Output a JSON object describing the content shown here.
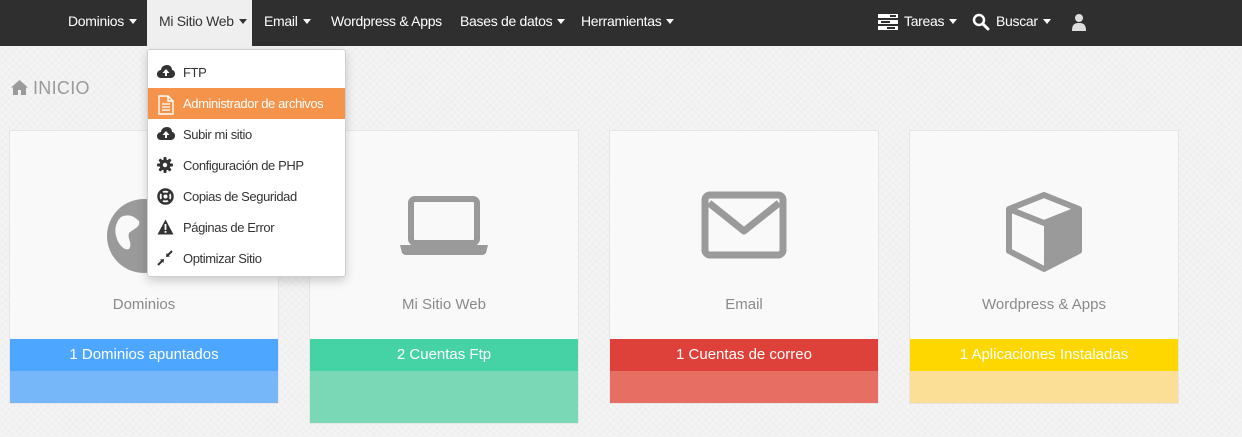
{
  "navbar": {
    "items": [
      {
        "label": "Dominios",
        "active": false
      },
      {
        "label": "Mi Sitio Web",
        "active": true
      },
      {
        "label": "Email",
        "active": false
      },
      {
        "label": "Wordpress & Apps",
        "active": false
      },
      {
        "label": "Bases de datos",
        "active": false
      },
      {
        "label": "Herramientas",
        "active": false
      }
    ],
    "tasks_label": "Tareas",
    "search_label": "Buscar",
    "user_icon": "user-icon"
  },
  "dropdown": {
    "items": [
      {
        "label": "FTP",
        "icon": "cloud-upload-icon"
      },
      {
        "label": "Administrador de archivos",
        "icon": "file-icon",
        "active": true
      },
      {
        "label": "Subir mi sitio",
        "icon": "cloud-upload-icon"
      },
      {
        "label": "Configuración de PHP",
        "icon": "gear-icon"
      },
      {
        "label": "Copias de Seguridad",
        "icon": "lifebuoy-icon"
      },
      {
        "label": "Páginas de Error",
        "icon": "warning-icon"
      },
      {
        "label": "Optimizar Sitio",
        "icon": "compress-icon"
      }
    ],
    "active_color": "#f49349"
  },
  "page": {
    "title": "INICIO"
  },
  "cards": [
    {
      "label": "Dominios",
      "stat": "1 Dominios apuntados",
      "icon": "globe-icon",
      "band_color": "#4da6ff",
      "foot_color": "#75b7f9"
    },
    {
      "label": "Mi Sitio Web",
      "stat": "2 Cuentas Ftp",
      "icon": "laptop-icon",
      "band_color": "#45d3a5",
      "foot_color": "#7ad8b7"
    },
    {
      "label": "Email",
      "stat": "1 Cuentas de correo",
      "icon": "envelope-icon",
      "band_color": "#de4139",
      "foot_color": "#e76e62"
    },
    {
      "label": "Wordpress & Apps",
      "stat": "1 Aplicaciones Instaladas",
      "icon": "cube-icon",
      "band_color": "#ffd700",
      "foot_color": "#fbdf97"
    }
  ]
}
